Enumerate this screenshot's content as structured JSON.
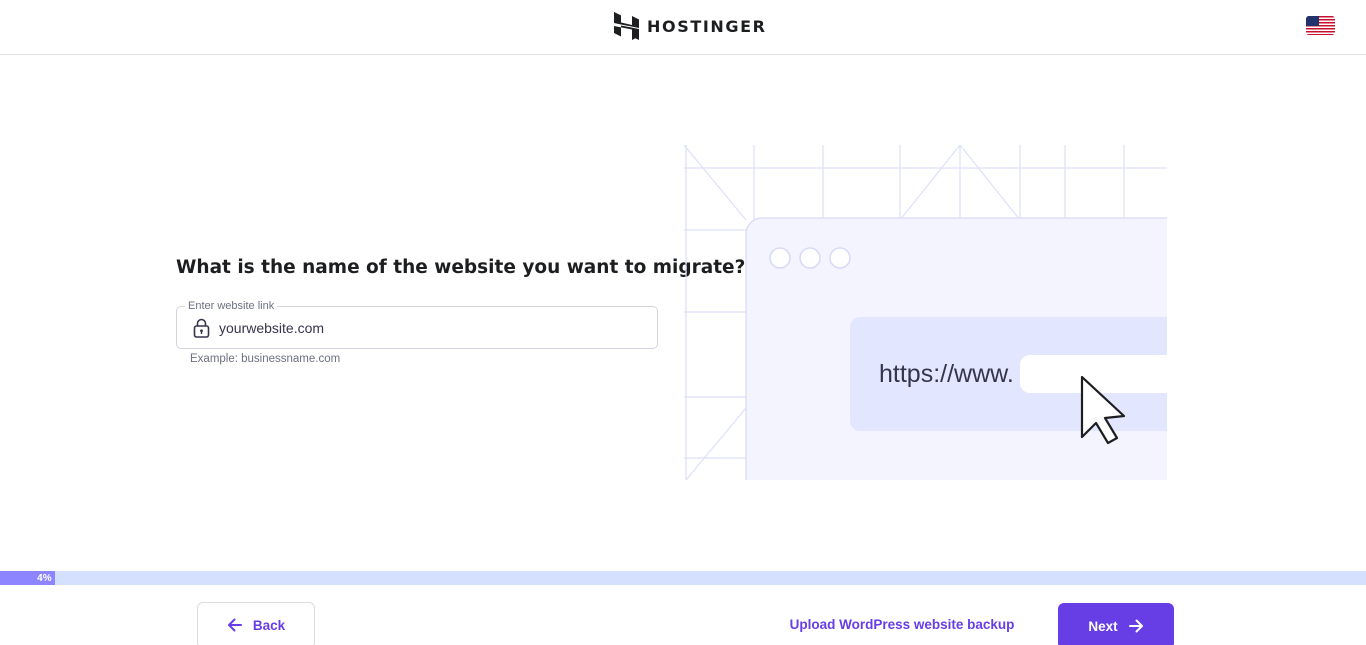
{
  "header": {
    "brand": "HOSTINGER",
    "language_flag": "us-flag-icon"
  },
  "form": {
    "question": "What is the name of the website you want to migrate?",
    "field_label": "Enter website link",
    "field_placeholder": "yourwebsite.com",
    "field_icon": "lock-icon",
    "hint": "Example: businessname.com"
  },
  "illustration": {
    "url_text": "https://www."
  },
  "progress": {
    "percent": 4,
    "label": "4%"
  },
  "footer": {
    "back_label": "Back",
    "upload_label": "Upload WordPress website backup",
    "next_label": "Next"
  },
  "colors": {
    "accent": "#673de6",
    "progress_fill": "#8c85ff",
    "progress_track": "#d5dfff",
    "illustration_bg": "#f3f4ff",
    "illustration_panel": "#e3e6ff"
  }
}
